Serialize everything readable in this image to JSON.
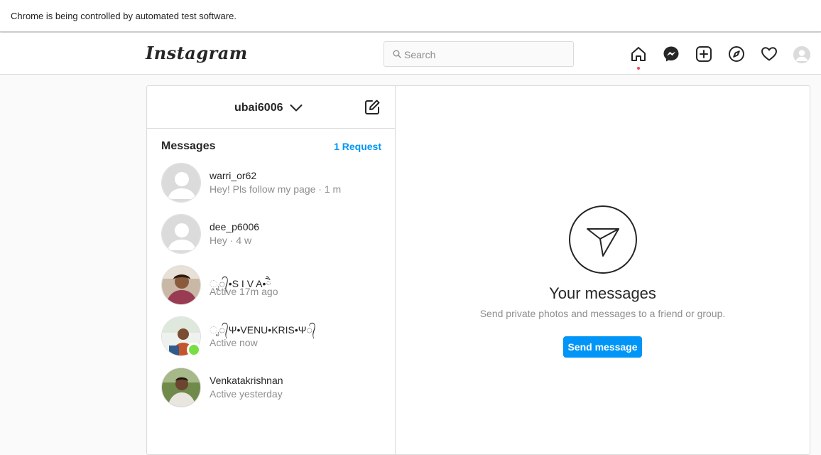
{
  "browser": {
    "infobar_text": "Chrome is being controlled by automated test software."
  },
  "nav": {
    "logo": "Instagram",
    "search_placeholder": "Search",
    "icons": [
      "home-icon",
      "messenger-icon",
      "new-post-icon",
      "explore-icon",
      "activity-heart-icon",
      "profile-avatar"
    ]
  },
  "inbox": {
    "account": "ubai6006",
    "title": "Messages",
    "requests": "1 Request",
    "threads": [
      {
        "name": "warri_or62",
        "sub": "Hey! Pls follow my page · 1 m"
      },
      {
        "name": "dee_p6006",
        "sub": "Hey · 4 w"
      },
      {
        "name": "ೃ᭄•S I V A•ཻ",
        "sub": "Active 17m ago"
      },
      {
        "name": "ೃ᭄Ψ•VENU•KRIS•Ψ᭄",
        "sub": "Active now"
      },
      {
        "name": "Venkatakrishnan",
        "sub": "Active yesterday"
      }
    ]
  },
  "empty_state": {
    "title": "Your messages",
    "subtitle": "Send private photos and messages to a friend or group.",
    "button": "Send message"
  },
  "colors": {
    "accent": "#0095f6",
    "online": "#78de45",
    "notification_dot": "#ed4956"
  }
}
